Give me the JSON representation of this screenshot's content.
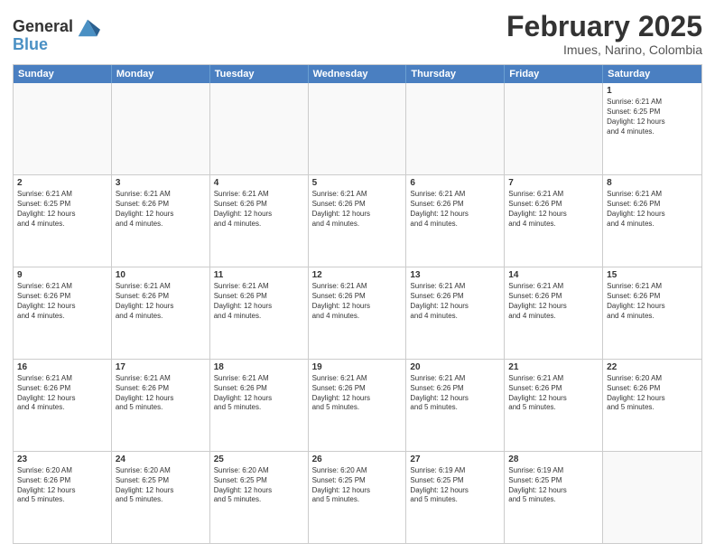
{
  "logo": {
    "line1": "General",
    "line2": "Blue"
  },
  "title": "February 2025",
  "subtitle": "Imues, Narino, Colombia",
  "days": [
    "Sunday",
    "Monday",
    "Tuesday",
    "Wednesday",
    "Thursday",
    "Friday",
    "Saturday"
  ],
  "weeks": [
    [
      {
        "day": "",
        "empty": true
      },
      {
        "day": "",
        "empty": true
      },
      {
        "day": "",
        "empty": true
      },
      {
        "day": "",
        "empty": true
      },
      {
        "day": "",
        "empty": true
      },
      {
        "day": "",
        "empty": true
      },
      {
        "day": "1",
        "info": "Sunrise: 6:21 AM\nSunset: 6:25 PM\nDaylight: 12 hours\nand 4 minutes."
      }
    ],
    [
      {
        "day": "2",
        "info": "Sunrise: 6:21 AM\nSunset: 6:25 PM\nDaylight: 12 hours\nand 4 minutes."
      },
      {
        "day": "3",
        "info": "Sunrise: 6:21 AM\nSunset: 6:26 PM\nDaylight: 12 hours\nand 4 minutes."
      },
      {
        "day": "4",
        "info": "Sunrise: 6:21 AM\nSunset: 6:26 PM\nDaylight: 12 hours\nand 4 minutes."
      },
      {
        "day": "5",
        "info": "Sunrise: 6:21 AM\nSunset: 6:26 PM\nDaylight: 12 hours\nand 4 minutes."
      },
      {
        "day": "6",
        "info": "Sunrise: 6:21 AM\nSunset: 6:26 PM\nDaylight: 12 hours\nand 4 minutes."
      },
      {
        "day": "7",
        "info": "Sunrise: 6:21 AM\nSunset: 6:26 PM\nDaylight: 12 hours\nand 4 minutes."
      },
      {
        "day": "8",
        "info": "Sunrise: 6:21 AM\nSunset: 6:26 PM\nDaylight: 12 hours\nand 4 minutes."
      }
    ],
    [
      {
        "day": "9",
        "info": "Sunrise: 6:21 AM\nSunset: 6:26 PM\nDaylight: 12 hours\nand 4 minutes."
      },
      {
        "day": "10",
        "info": "Sunrise: 6:21 AM\nSunset: 6:26 PM\nDaylight: 12 hours\nand 4 minutes."
      },
      {
        "day": "11",
        "info": "Sunrise: 6:21 AM\nSunset: 6:26 PM\nDaylight: 12 hours\nand 4 minutes."
      },
      {
        "day": "12",
        "info": "Sunrise: 6:21 AM\nSunset: 6:26 PM\nDaylight: 12 hours\nand 4 minutes."
      },
      {
        "day": "13",
        "info": "Sunrise: 6:21 AM\nSunset: 6:26 PM\nDaylight: 12 hours\nand 4 minutes."
      },
      {
        "day": "14",
        "info": "Sunrise: 6:21 AM\nSunset: 6:26 PM\nDaylight: 12 hours\nand 4 minutes."
      },
      {
        "day": "15",
        "info": "Sunrise: 6:21 AM\nSunset: 6:26 PM\nDaylight: 12 hours\nand 4 minutes."
      }
    ],
    [
      {
        "day": "16",
        "info": "Sunrise: 6:21 AM\nSunset: 6:26 PM\nDaylight: 12 hours\nand 4 minutes."
      },
      {
        "day": "17",
        "info": "Sunrise: 6:21 AM\nSunset: 6:26 PM\nDaylight: 12 hours\nand 5 minutes."
      },
      {
        "day": "18",
        "info": "Sunrise: 6:21 AM\nSunset: 6:26 PM\nDaylight: 12 hours\nand 5 minutes."
      },
      {
        "day": "19",
        "info": "Sunrise: 6:21 AM\nSunset: 6:26 PM\nDaylight: 12 hours\nand 5 minutes."
      },
      {
        "day": "20",
        "info": "Sunrise: 6:21 AM\nSunset: 6:26 PM\nDaylight: 12 hours\nand 5 minutes."
      },
      {
        "day": "21",
        "info": "Sunrise: 6:21 AM\nSunset: 6:26 PM\nDaylight: 12 hours\nand 5 minutes."
      },
      {
        "day": "22",
        "info": "Sunrise: 6:20 AM\nSunset: 6:26 PM\nDaylight: 12 hours\nand 5 minutes."
      }
    ],
    [
      {
        "day": "23",
        "info": "Sunrise: 6:20 AM\nSunset: 6:26 PM\nDaylight: 12 hours\nand 5 minutes."
      },
      {
        "day": "24",
        "info": "Sunrise: 6:20 AM\nSunset: 6:25 PM\nDaylight: 12 hours\nand 5 minutes."
      },
      {
        "day": "25",
        "info": "Sunrise: 6:20 AM\nSunset: 6:25 PM\nDaylight: 12 hours\nand 5 minutes."
      },
      {
        "day": "26",
        "info": "Sunrise: 6:20 AM\nSunset: 6:25 PM\nDaylight: 12 hours\nand 5 minutes."
      },
      {
        "day": "27",
        "info": "Sunrise: 6:19 AM\nSunset: 6:25 PM\nDaylight: 12 hours\nand 5 minutes."
      },
      {
        "day": "28",
        "info": "Sunrise: 6:19 AM\nSunset: 6:25 PM\nDaylight: 12 hours\nand 5 minutes."
      },
      {
        "day": "",
        "empty": true
      }
    ]
  ]
}
